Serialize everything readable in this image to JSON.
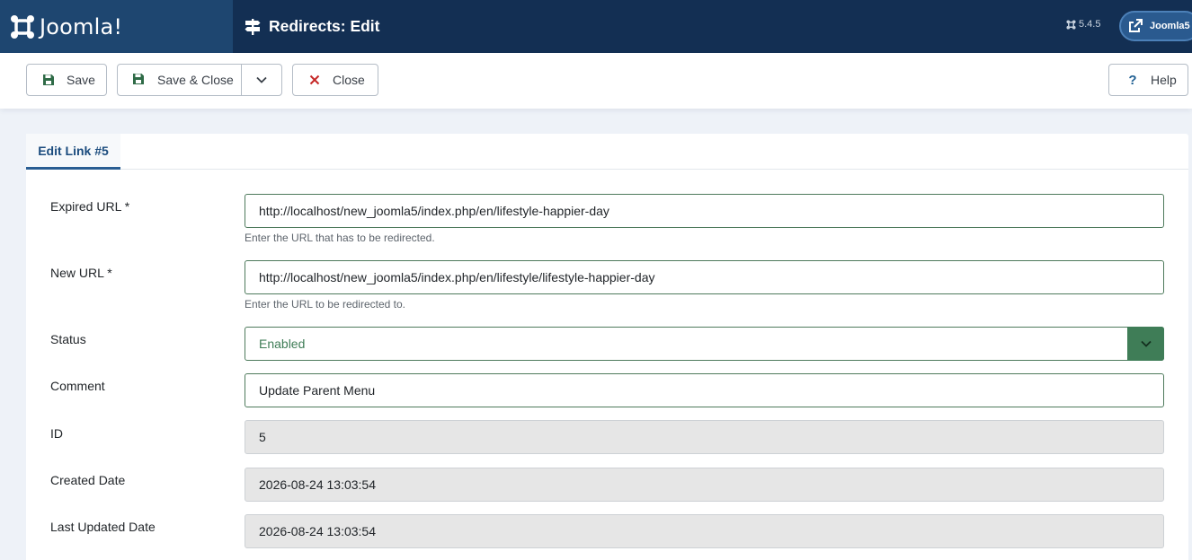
{
  "header": {
    "logo_text": "Joomla!",
    "page_title": "Redirects: Edit",
    "version": "5.4.5",
    "user_label": "Joomla5"
  },
  "toolbar": {
    "save_label": "Save",
    "save_close_label": "Save & Close",
    "close_label": "Close",
    "help_label": "Help"
  },
  "tabs": [
    {
      "label": "Edit Link #5",
      "active": true
    }
  ],
  "form": {
    "expired_url": {
      "label": "Expired URL *",
      "value": "http://localhost/new_joomla5/index.php/en/lifestyle-happier-day",
      "hint": "Enter the URL that has to be redirected."
    },
    "new_url": {
      "label": "New URL *",
      "value": "http://localhost/new_joomla5/index.php/en/lifestyle/lifestyle-happier-day",
      "hint": "Enter the URL to be redirected to."
    },
    "status": {
      "label": "Status",
      "value": "Enabled"
    },
    "comment": {
      "label": "Comment",
      "value": "Update Parent Menu"
    },
    "id": {
      "label": "ID",
      "value": "5"
    },
    "created_date": {
      "label": "Created Date",
      "value": "2026-08-24 13:03:54"
    },
    "last_updated_date": {
      "label": "Last Updated Date",
      "value": "2026-08-24 13:03:54"
    }
  },
  "icons": {
    "logo": "joomla-logo-icon",
    "title": "signpost-icon",
    "version": "joomla-small-icon",
    "user": "external-link-icon",
    "save": "floppy-disk-icon",
    "save_close": "floppy-disk-icon",
    "dropdown": "chevron-down-icon",
    "close": "x-mark-icon",
    "help": "question-mark-icon",
    "select": "chevron-down-icon"
  },
  "colors": {
    "header_bg": "#132f53",
    "logo_bg": "#1e4670",
    "success_green": "#3f7d57",
    "danger_red": "#c52827",
    "tab_accent": "#2a5e93"
  }
}
